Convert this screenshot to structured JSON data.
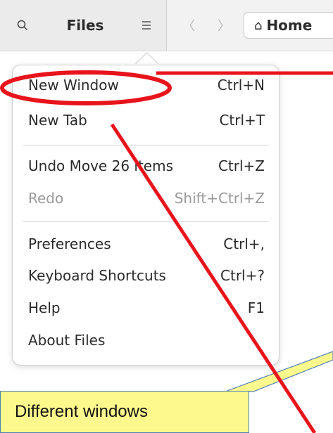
{
  "header": {
    "search_icon": "search-icon",
    "title": "Files",
    "menu_icon": "hamburger-icon",
    "back_icon": "chevron-left-icon",
    "forward_icon": "chevron-right-icon",
    "path": {
      "icon": "home-icon",
      "label": "Home"
    }
  },
  "menu": {
    "items": [
      {
        "label": "New Window",
        "shortcut": "Ctrl+N",
        "enabled": true
      },
      {
        "label": "New Tab",
        "shortcut": "Ctrl+T",
        "enabled": true
      },
      {
        "label": "Undo Move 26 items",
        "shortcut": "Ctrl+Z",
        "enabled": true
      },
      {
        "label": "Redo",
        "shortcut": "Shift+Ctrl+Z",
        "enabled": false
      },
      {
        "label": "Preferences",
        "shortcut": "Ctrl+,",
        "enabled": true
      },
      {
        "label": "Keyboard Shortcuts",
        "shortcut": "Ctrl+?",
        "enabled": true
      },
      {
        "label": "Help",
        "shortcut": "F1",
        "enabled": true
      },
      {
        "label": "About Files",
        "shortcut": "",
        "enabled": true
      }
    ]
  },
  "annotation": {
    "callout_text": "Different windows",
    "colors": {
      "marker": "#e8141c",
      "callout_bg": "#fdf98d",
      "callout_border": "#4a7fb5"
    }
  }
}
